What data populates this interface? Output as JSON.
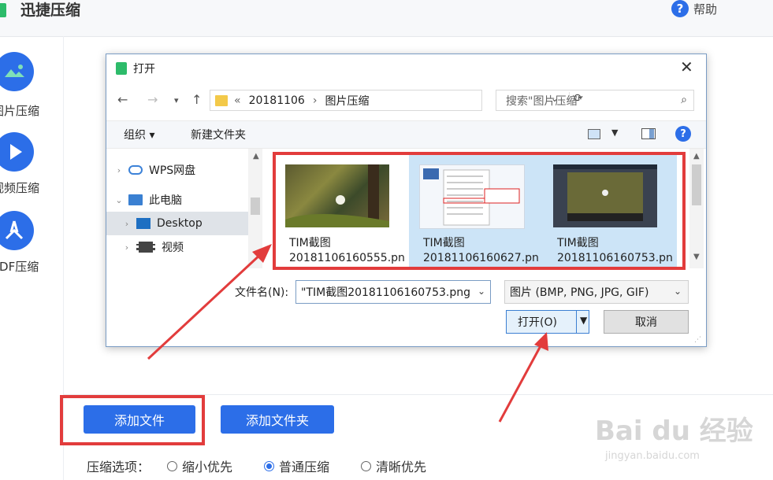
{
  "app": {
    "title": "迅捷压缩",
    "help_label": "帮助"
  },
  "sidebar": {
    "items": [
      {
        "label": "图片压缩",
        "icon": "image-icon"
      },
      {
        "label": "视频压缩",
        "icon": "play-icon"
      },
      {
        "label": "PDF压缩",
        "icon": "pdf-icon"
      }
    ]
  },
  "dialog": {
    "title": "打开",
    "address": {
      "prefix": "«",
      "segments": [
        "20181106",
        "图片压缩"
      ],
      "separator": "›"
    },
    "search_placeholder": "搜索\"图片压缩\"",
    "toolbar": {
      "organize": "组织 ▾",
      "new_folder": "新建文件夹"
    },
    "nav_pane": [
      {
        "label": "WPS网盘",
        "icon": "cloud-icon"
      },
      {
        "label": "此电脑",
        "icon": "computer-icon"
      },
      {
        "label": "Desktop",
        "icon": "desktop-icon"
      },
      {
        "label": "视频",
        "icon": "video-icon"
      }
    ],
    "files": [
      {
        "name_line1": "TIM截图",
        "name_line2": "20181106160555.pn"
      },
      {
        "name_line1": "TIM截图",
        "name_line2": "20181106160627.pn"
      },
      {
        "name_line1": "TIM截图",
        "name_line2": "20181106160753.pn"
      }
    ],
    "filename_label": "文件名(N):",
    "filename_value": "\"TIM截图20181106160753.png",
    "filetype_value": "图片 (BMP, PNG, JPG, GIF)",
    "open_label": "打开(O)",
    "cancel_label": "取消"
  },
  "bottom": {
    "add_file": "添加文件",
    "add_folder": "添加文件夹",
    "options_label": "压缩选项：",
    "options": [
      {
        "label": "缩小优先",
        "checked": false
      },
      {
        "label": "普通压缩",
        "checked": true
      },
      {
        "label": "清晰优先",
        "checked": false
      }
    ]
  },
  "watermark": {
    "main": "Bai du 经验",
    "sub": "jingyan.baidu.com"
  },
  "colors": {
    "accent": "#2c6ee8",
    "annotation": "#e23c3c",
    "selection": "#cce4f7"
  }
}
